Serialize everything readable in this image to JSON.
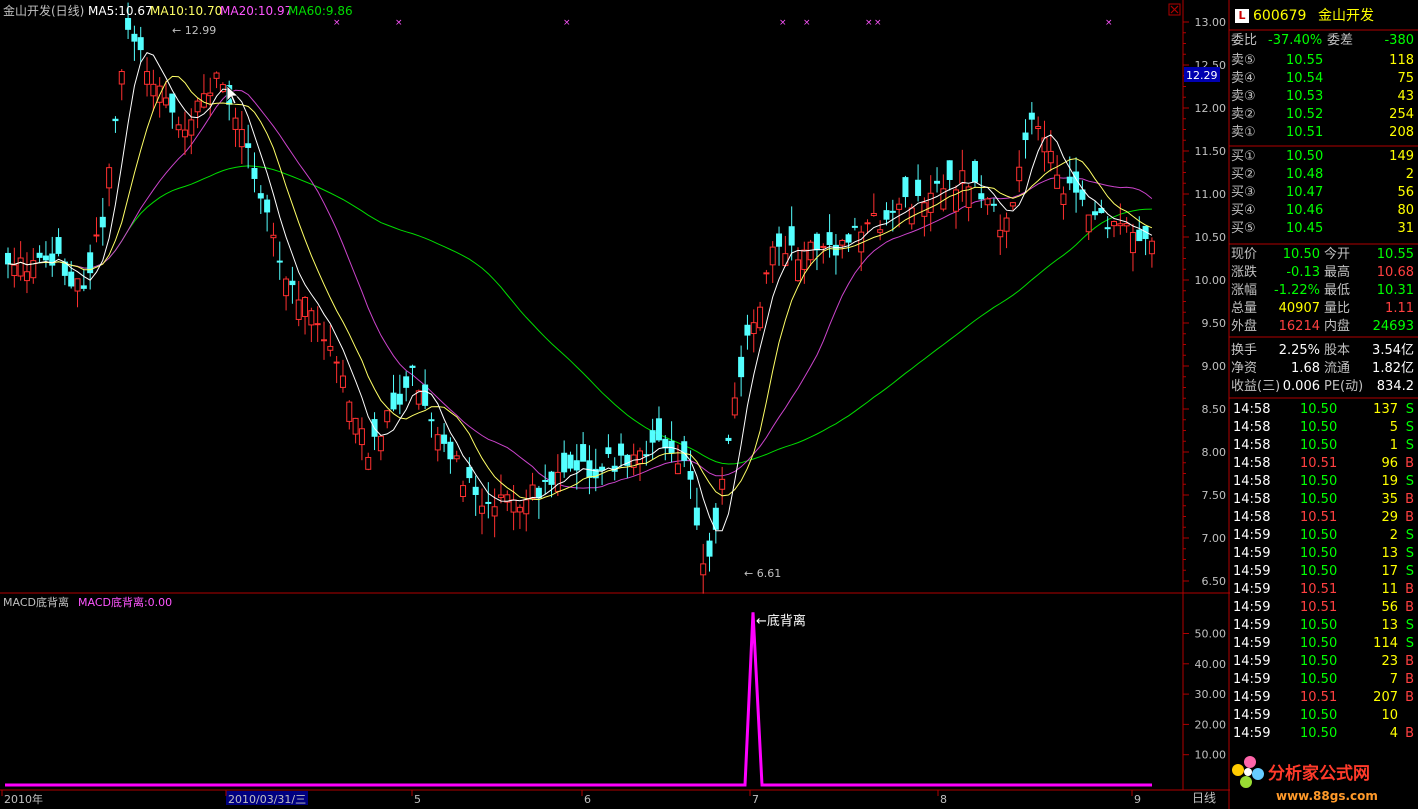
{
  "app": {
    "title": "金山开发(日线)",
    "stock_code": "600679",
    "stock_name": "金山开发",
    "l_badge": "L",
    "period_label": "日线"
  },
  "ma_legend": [
    {
      "label": "MA5:10.67",
      "color": "#ffffff"
    },
    {
      "label": "MA10:10.70",
      "color": "#ffff66"
    },
    {
      "label": "MA20:10.97",
      "color": "#ff55ff"
    },
    {
      "label": "MA60:9.86",
      "color": "#00dd00"
    }
  ],
  "chart_annotations": {
    "high_label": "12.99",
    "low_label": "6.61",
    "divergence_label": "底背离",
    "current_price_tag": "12.29"
  },
  "indicator": {
    "name": "MACD底背离",
    "value_label": "MACD底背离:0.00"
  },
  "price_axis": [
    "13.00",
    "12.50",
    "12.00",
    "11.50",
    "11.00",
    "10.50",
    "10.00",
    "9.50",
    "9.00",
    "8.50",
    "8.00",
    "7.50",
    "7.00",
    "6.50"
  ],
  "indicator_axis": [
    "50.00",
    "40.00",
    "30.00",
    "20.00",
    "10.00"
  ],
  "date_axis": [
    "2010年",
    "2010/03/31/三",
    "5",
    "6",
    "7",
    "8",
    "9"
  ],
  "order_ratio": {
    "label1": "委比",
    "value1": "-37.40%",
    "label2": "委差",
    "value2": "-380"
  },
  "asks": [
    {
      "label": "卖⑤",
      "price": "10.55",
      "vol": "118"
    },
    {
      "label": "卖④",
      "price": "10.54",
      "vol": "75"
    },
    {
      "label": "卖③",
      "price": "10.53",
      "vol": "43"
    },
    {
      "label": "卖②",
      "price": "10.52",
      "vol": "254"
    },
    {
      "label": "卖①",
      "price": "10.51",
      "vol": "208"
    }
  ],
  "bids": [
    {
      "label": "买①",
      "price": "10.50",
      "vol": "149"
    },
    {
      "label": "买②",
      "price": "10.48",
      "vol": "2"
    },
    {
      "label": "买③",
      "price": "10.47",
      "vol": "56"
    },
    {
      "label": "买④",
      "price": "10.46",
      "vol": "80"
    },
    {
      "label": "买⑤",
      "price": "10.45",
      "vol": "31"
    }
  ],
  "stats": [
    {
      "l1": "现价",
      "v1": "10.50",
      "c1": "#00ff00",
      "l2": "今开",
      "v2": "10.55",
      "c2": "#00ff00"
    },
    {
      "l1": "涨跌",
      "v1": "-0.13",
      "c1": "#00ff00",
      "l2": "最高",
      "v2": "10.68",
      "c2": "#ff4040"
    },
    {
      "l1": "涨幅",
      "v1": "-1.22%",
      "c1": "#00ff00",
      "l2": "最低",
      "v2": "10.31",
      "c2": "#00ff00"
    },
    {
      "l1": "总量",
      "v1": "40907",
      "c1": "#ffff00",
      "l2": "量比",
      "v2": "1.11",
      "c2": "#ff4040"
    },
    {
      "l1": "外盘",
      "v1": "16214",
      "c1": "#ff4040",
      "l2": "内盘",
      "v2": "24693",
      "c2": "#00ff00"
    }
  ],
  "stats2": [
    {
      "l1": "换手",
      "v1": "2.25%",
      "l2": "股本",
      "v2": "3.54亿"
    },
    {
      "l1": "净资",
      "v1": "1.68",
      "l2": "流通",
      "v2": "1.82亿"
    },
    {
      "l1": "收益(三)",
      "v1": "0.006",
      "l2": "PE(动)",
      "v2": "834.2"
    }
  ],
  "ticks": [
    {
      "time": "14:58",
      "price": "10.50",
      "vol": "137",
      "side": "S"
    },
    {
      "time": "14:58",
      "price": "10.50",
      "vol": "5",
      "side": "S"
    },
    {
      "time": "14:58",
      "price": "10.50",
      "vol": "1",
      "side": "S"
    },
    {
      "time": "14:58",
      "price": "10.51",
      "vol": "96",
      "side": "B"
    },
    {
      "time": "14:58",
      "price": "10.50",
      "vol": "19",
      "side": "S"
    },
    {
      "time": "14:58",
      "price": "10.50",
      "vol": "35",
      "side": "B"
    },
    {
      "time": "14:58",
      "price": "10.51",
      "vol": "29",
      "side": "B"
    },
    {
      "time": "14:59",
      "price": "10.50",
      "vol": "2",
      "side": "S"
    },
    {
      "time": "14:59",
      "price": "10.50",
      "vol": "13",
      "side": "S"
    },
    {
      "time": "14:59",
      "price": "10.50",
      "vol": "17",
      "side": "S"
    },
    {
      "time": "14:59",
      "price": "10.51",
      "vol": "11",
      "side": "B"
    },
    {
      "time": "14:59",
      "price": "10.51",
      "vol": "56",
      "side": "B"
    },
    {
      "time": "14:59",
      "price": "10.50",
      "vol": "13",
      "side": "S"
    },
    {
      "time": "14:59",
      "price": "10.50",
      "vol": "114",
      "side": "S"
    },
    {
      "time": "14:59",
      "price": "10.50",
      "vol": "23",
      "side": "B"
    },
    {
      "time": "14:59",
      "price": "10.50",
      "vol": "7",
      "side": "B"
    },
    {
      "time": "14:59",
      "price": "10.51",
      "vol": "207",
      "side": "B"
    },
    {
      "time": "14:59",
      "price": "10.50",
      "vol": "10",
      "side": ""
    },
    {
      "time": "14:59",
      "price": "10.50",
      "vol": "4",
      "side": "B"
    }
  ],
  "watermark": {
    "text": "分析家公式网",
    "url": "www.88gs.com"
  },
  "colors": {
    "up": "#ff3030",
    "down": "#54ffff",
    "ma5": "#ffffff",
    "ma10": "#ffff66",
    "ma20": "#cc44cc",
    "ma60": "#00dd00",
    "axis": "#b00000",
    "indicator": "#ff00ff"
  }
}
